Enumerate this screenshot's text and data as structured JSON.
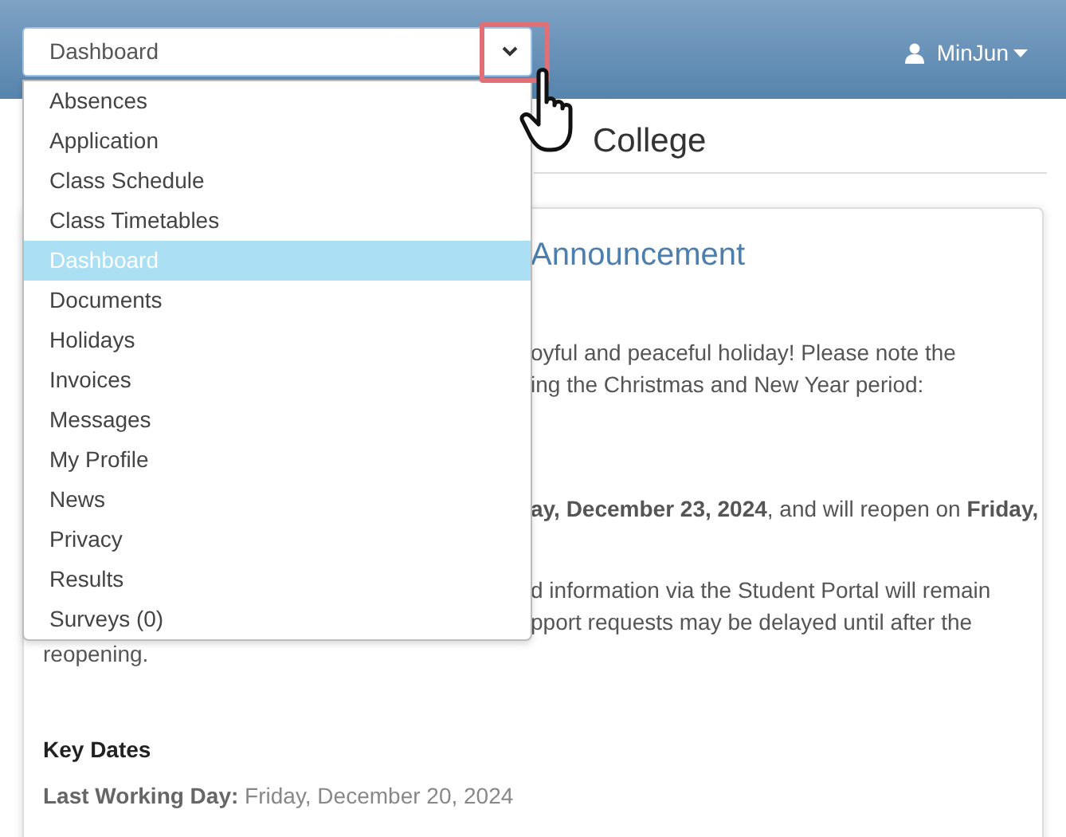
{
  "navigation": {
    "select_value": "Dashboard",
    "menu_open": true,
    "options": [
      {
        "label": "Absences",
        "selected": false
      },
      {
        "label": "Application",
        "selected": false
      },
      {
        "label": "Class Schedule",
        "selected": false
      },
      {
        "label": "Class Timetables",
        "selected": false
      },
      {
        "label": "Dashboard",
        "selected": true
      },
      {
        "label": "Documents",
        "selected": false
      },
      {
        "label": "Holidays",
        "selected": false
      },
      {
        "label": "Invoices",
        "selected": false
      },
      {
        "label": "Messages",
        "selected": false
      },
      {
        "label": "My Profile",
        "selected": false
      },
      {
        "label": "News",
        "selected": false
      },
      {
        "label": "Privacy",
        "selected": false
      },
      {
        "label": "Results",
        "selected": false
      },
      {
        "label": "Surveys (0)",
        "selected": false
      }
    ]
  },
  "user": {
    "name": "MinJun"
  },
  "page": {
    "title": "College"
  },
  "announcement": {
    "heading": "Announcement",
    "paragraphs": [
      {
        "lines": [
          {
            "kind": "cut",
            "text": "oyful and peaceful holiday! Please note the"
          },
          {
            "kind": "cut",
            "text": "ing the Christmas and New Year period:"
          }
        ]
      },
      {
        "lines": [
          {
            "kind": "cut",
            "text": "**ay, December 23, 2024**, and will reopen on **Friday,**"
          }
        ]
      },
      {
        "lines": [
          {
            "kind": "cut",
            "text": "d information via the Student Portal will remain"
          },
          {
            "kind": "cut",
            "text": "pport requests may be delayed until after the"
          },
          {
            "kind": "full",
            "text": "reopening."
          }
        ]
      }
    ],
    "key_dates": {
      "heading": "Key Dates",
      "first_label": "Last Working Day:",
      "first_value": "Friday, December 20, 2024"
    }
  }
}
